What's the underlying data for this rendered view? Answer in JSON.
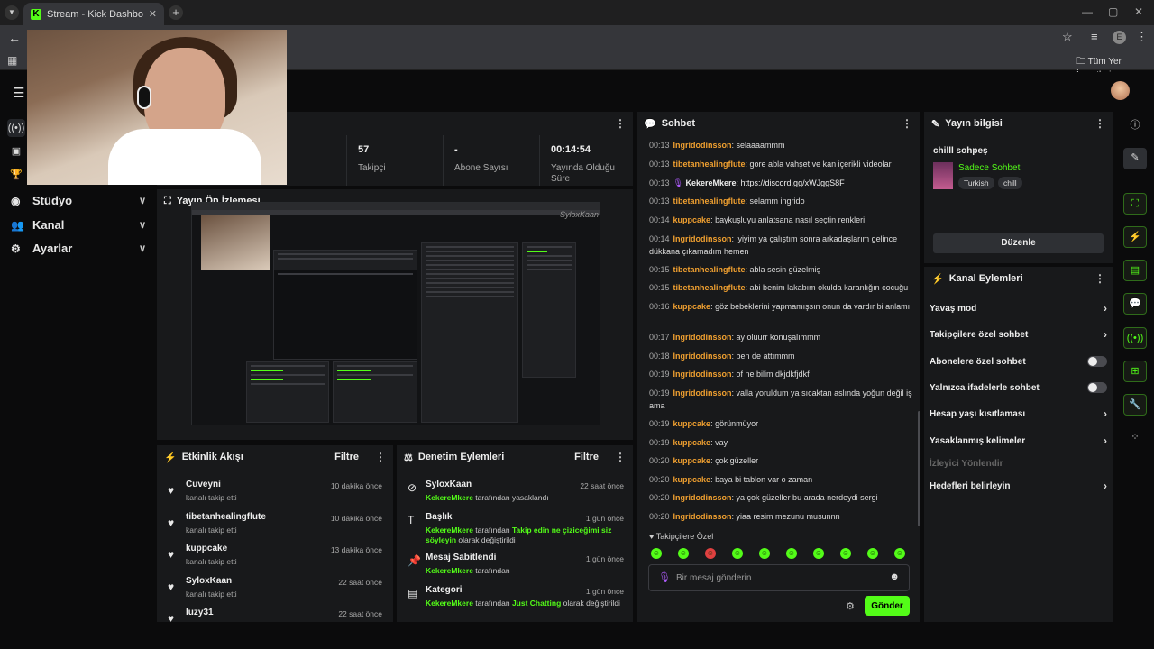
{
  "browser": {
    "tab_title": "Stream - Kick Dashboard",
    "tab_close": "✕",
    "new_tab": "+",
    "bookmarks_all": "Tüm Yer İşaretleri",
    "profile_initial": "E",
    "win_min": "—",
    "win_max": "▢",
    "win_close": "✕"
  },
  "nav": {
    "items": [
      {
        "label": "Stüdyo"
      },
      {
        "label": "Kanal"
      },
      {
        "label": "Ayarlar"
      }
    ]
  },
  "stats": {
    "cells": [
      {
        "value": "57",
        "label": "Takipçi"
      },
      {
        "value": "-",
        "label": "Abone Sayısı"
      },
      {
        "value": "00:14:54",
        "label": "Yayında Olduğu Süre"
      }
    ]
  },
  "preview": {
    "title": "Yayın Ön İzlemesi",
    "logo_text": "SyloxKaan"
  },
  "activity": {
    "title": "Etkinlik Akışı",
    "filter": "Filtre",
    "items": [
      {
        "name": "Cuveyni",
        "desc": "kanalı takip etti",
        "time": "10 dakika önce"
      },
      {
        "name": "tibetanhealingflute",
        "desc": "kanalı takip etti",
        "time": "10 dakika önce"
      },
      {
        "name": "kuppcake",
        "desc": "kanalı takip etti",
        "time": "13 dakika önce"
      },
      {
        "name": "SyloxKaan",
        "desc": "kanalı takip etti",
        "time": "22 saat önce"
      },
      {
        "name": "luzy31",
        "desc": "",
        "time": "22 saat önce"
      }
    ]
  },
  "moderation": {
    "title": "Denetim Eylemleri",
    "filter": "Filtre",
    "items": [
      {
        "name": "SyloxKaan",
        "time": "22 saat önce",
        "user": "KekereMkere",
        "text": " tarafından yasaklandı",
        "highlight": "",
        "tail": ""
      },
      {
        "name": "Başlık",
        "time": "1 gün önce",
        "user": "KekereMkere",
        "text": " tarafından ",
        "highlight": "Takip edin ne çiziceğimi siz söyleyin",
        "tail": " olarak değiştirildi"
      },
      {
        "name": "Mesaj Sabitlendi",
        "time": "1 gün önce",
        "user": "KekereMkere",
        "text": " tarafından",
        "highlight": "",
        "tail": ""
      },
      {
        "name": "Kategori",
        "time": "1 gün önce",
        "user": "KekereMkere",
        "text": " tarafından ",
        "highlight": "Just Chatting",
        "tail": " olarak değiştirildi"
      }
    ]
  },
  "chat": {
    "title": "Sohbet",
    "messages": [
      {
        "time": "00:13",
        "user": "Ingridodinsson",
        "color": "orange",
        "text": ": selaaaammm"
      },
      {
        "time": "00:13",
        "user": "tibetanhealingflute",
        "color": "orange",
        "text": ": gore abla vahşet ve kan içerikli videolar"
      },
      {
        "time": "00:13",
        "user": "KekereMkere",
        "color": "white",
        "text": ": ",
        "link": "https://discord.gg/xWJggS8F"
      },
      {
        "time": "00:13",
        "user": "tibetanhealingflute",
        "color": "orange",
        "text": ": selamm ingrido"
      },
      {
        "time": "00:14",
        "user": "kuppcake",
        "color": "orange",
        "text": ": baykuşluyu anlatsana nasıl seçtin renkleri"
      },
      {
        "time": "00:14",
        "user": "Ingridodinsson",
        "color": "orange",
        "text": ": iyiyim ya çalıştım sonra arkadaşlarım gelince dükkana çıkamadım hemen"
      },
      {
        "time": "00:15",
        "user": "tibetanhealingflute",
        "color": "orange",
        "text": ": abla sesin güzelmiş"
      },
      {
        "time": "00:15",
        "user": "tibetanhealingflute",
        "color": "orange",
        "text": ": abi benim lakabım okulda karanlığın cocuğu"
      },
      {
        "time": "00:16",
        "user": "kuppcake",
        "color": "orange",
        "text": ": göz bebeklerini yapmamışsın onun da vardır bi anlamı"
      },
      {
        "time": "00:17",
        "user": "Ingridodinsson",
        "color": "orange",
        "text": ": ay oluurr konuşalımmm"
      },
      {
        "time": "00:18",
        "user": "Ingridodinsson",
        "color": "orange",
        "text": ": ben de attımmm"
      },
      {
        "time": "00:19",
        "user": "Ingridodinsson",
        "color": "orange",
        "text": ": of ne bilim dkjdkfjdkf"
      },
      {
        "time": "00:19",
        "user": "Ingridodinsson",
        "color": "orange",
        "text": ": valla yoruldum ya sıcaktan aslında yoğun değil iş ama"
      },
      {
        "time": "00:19",
        "user": "kuppcake",
        "color": "orange",
        "text": ": görünmüyor"
      },
      {
        "time": "00:19",
        "user": "kuppcake",
        "color": "orange",
        "text": ": vay"
      },
      {
        "time": "00:20",
        "user": "kuppcake",
        "color": "orange",
        "text": ": çok güzeller"
      },
      {
        "time": "00:20",
        "user": "kuppcake",
        "color": "orange",
        "text": ": baya bi tablon var o zaman"
      },
      {
        "time": "00:20",
        "user": "Ingridodinsson",
        "color": "orange",
        "text": ": ya çok güzeller bu arada nerdeydi sergi"
      },
      {
        "time": "00:20",
        "user": "Ingridodinsson",
        "color": "orange",
        "text": ": yiaa resim mezunu musunnn"
      }
    ],
    "followers_only": "Takipçilere Özel",
    "input_placeholder": "Bir mesaj gönderin",
    "send_label": "Gönder"
  },
  "stream_info": {
    "title": "Yayın bilgisi",
    "stream_title": "chilll sohpeş",
    "category": "Sadece Sohbet",
    "tags": [
      "Turkish",
      "chill"
    ],
    "edit_label": "Düzenle"
  },
  "channel_actions": {
    "title": "Kanal Eylemleri",
    "rows": [
      {
        "label": "Yavaş mod",
        "kind": "arrow"
      },
      {
        "label": "Takipçilere özel sohbet",
        "kind": "arrow"
      },
      {
        "label": "Abonelere özel sohbet",
        "kind": "toggle"
      },
      {
        "label": "Yalnızca ifadelerle sohbet",
        "kind": "toggle"
      },
      {
        "label": "Hesap yaşı kısıtlaması",
        "kind": "arrow"
      },
      {
        "label": "Yasaklanmış kelimeler",
        "kind": "arrow"
      },
      {
        "label": "İzleyici Yönlendir",
        "kind": "muted"
      },
      {
        "label": "Hedefleri belirleyin",
        "kind": "arrow"
      }
    ]
  },
  "colors": {
    "accent": "#53fc18",
    "username_orange": "#f0a030",
    "panel_bg": "#18191b"
  }
}
